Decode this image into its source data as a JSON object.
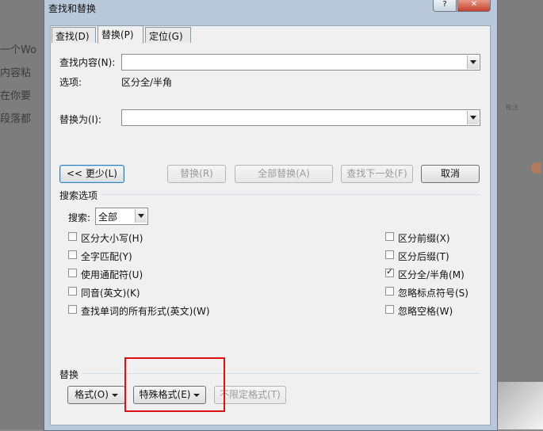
{
  "background": {
    "lines": [
      "一个Wo",
      "内容粘",
      "在你要",
      "段落都"
    ],
    "side_text": "批注"
  },
  "dialog": {
    "title": "查找和替换",
    "help_icon": "?",
    "close_icon": "✕"
  },
  "tabs": [
    {
      "label": "查找(D)",
      "active": false
    },
    {
      "label": "替换(P)",
      "active": true
    },
    {
      "label": "定位(G)",
      "active": false
    }
  ],
  "find": {
    "label": "查找内容(N):",
    "value": "",
    "options_label": "选项:",
    "options_value": "区分全/半角"
  },
  "replace": {
    "label": "替换为(I):",
    "value": ""
  },
  "buttons": {
    "less": "<< 更少(L)",
    "replace": "替换(R)",
    "replace_all": "全部替换(A)",
    "find_next": "查找下一处(F)",
    "cancel": "取消"
  },
  "search_options": {
    "header": "搜索选项",
    "search_label": "搜索:",
    "search_value": "全部",
    "left": [
      {
        "label": "区分大小写(H)",
        "checked": false
      },
      {
        "label": "全字匹配(Y)",
        "checked": false
      },
      {
        "label": "使用通配符(U)",
        "checked": false
      },
      {
        "label": "同音(英文)(K)",
        "checked": false
      },
      {
        "label": "查找单词的所有形式(英文)(W)",
        "checked": false
      }
    ],
    "right": [
      {
        "label": "区分前缀(X)",
        "checked": false
      },
      {
        "label": "区分后缀(T)",
        "checked": false
      },
      {
        "label": "区分全/半角(M)",
        "checked": true
      },
      {
        "label": "忽略标点符号(S)",
        "checked": false
      },
      {
        "label": "忽略空格(W)",
        "checked": false
      }
    ]
  },
  "replace_section": {
    "header": "替换",
    "format": "格式(O)",
    "special": "特殊格式(E)",
    "no_format": "不限定格式(T)"
  },
  "colors": {
    "highlight": "#e01010",
    "dialog_frame": "#b9c9da"
  }
}
